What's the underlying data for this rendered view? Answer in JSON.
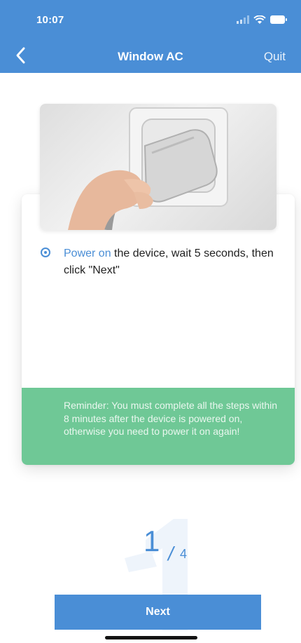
{
  "status_bar": {
    "time": "10:07",
    "icons": [
      "signal-icon",
      "wifi-icon",
      "battery-icon"
    ]
  },
  "nav": {
    "back_icon": "chevron-left-icon",
    "title": "Window AC",
    "quit_label": "Quit"
  },
  "instruction": {
    "highlight": "Power on",
    "text": " the device, wait 5 seconds, then click \"Next\""
  },
  "reminder": {
    "text": "Reminder: You must complete all the steps within 8 minutes after the device is powered on, otherwise you need  to power it on again!"
  },
  "step": {
    "current": "1",
    "separator": "/",
    "total": "4"
  },
  "actions": {
    "next_label": "Next"
  },
  "colors": {
    "primary": "#4a8ed6",
    "reminder_bg": "#6fc896",
    "background": "#ffffff"
  }
}
